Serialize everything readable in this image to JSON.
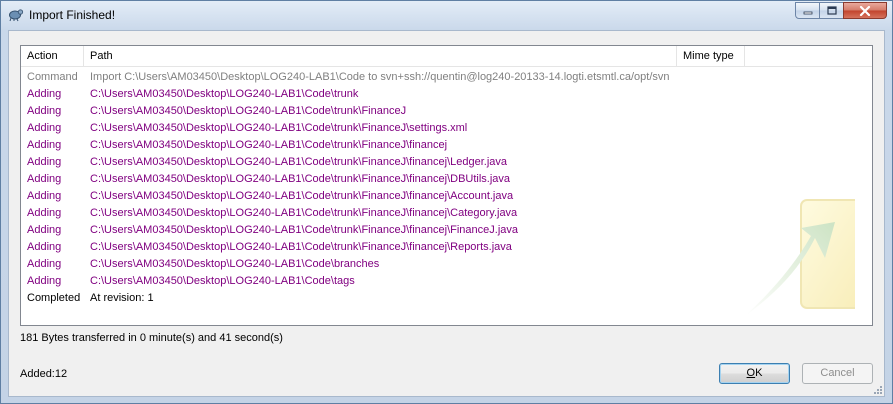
{
  "window": {
    "title": "Import Finished!"
  },
  "list": {
    "columns": [
      "Action",
      "Path",
      "Mime type"
    ],
    "rows": [
      {
        "action": "Command",
        "path": "Import C:\\Users\\AM03450\\Desktop\\LOG240-LAB1\\Code to svn+ssh://quentin@log240-20133-14.logti.etsmtl.ca/opt/svn",
        "kind": "command"
      },
      {
        "action": "Adding",
        "path": "C:\\Users\\AM03450\\Desktop\\LOG240-LAB1\\Code\\trunk",
        "kind": "adding"
      },
      {
        "action": "Adding",
        "path": "C:\\Users\\AM03450\\Desktop\\LOG240-LAB1\\Code\\trunk\\FinanceJ",
        "kind": "adding"
      },
      {
        "action": "Adding",
        "path": "C:\\Users\\AM03450\\Desktop\\LOG240-LAB1\\Code\\trunk\\FinanceJ\\settings.xml",
        "kind": "adding"
      },
      {
        "action": "Adding",
        "path": "C:\\Users\\AM03450\\Desktop\\LOG240-LAB1\\Code\\trunk\\FinanceJ\\financej",
        "kind": "adding"
      },
      {
        "action": "Adding",
        "path": "C:\\Users\\AM03450\\Desktop\\LOG240-LAB1\\Code\\trunk\\FinanceJ\\financej\\Ledger.java",
        "kind": "adding"
      },
      {
        "action": "Adding",
        "path": "C:\\Users\\AM03450\\Desktop\\LOG240-LAB1\\Code\\trunk\\FinanceJ\\financej\\DBUtils.java",
        "kind": "adding"
      },
      {
        "action": "Adding",
        "path": "C:\\Users\\AM03450\\Desktop\\LOG240-LAB1\\Code\\trunk\\FinanceJ\\financej\\Account.java",
        "kind": "adding"
      },
      {
        "action": "Adding",
        "path": "C:\\Users\\AM03450\\Desktop\\LOG240-LAB1\\Code\\trunk\\FinanceJ\\financej\\Category.java",
        "kind": "adding"
      },
      {
        "action": "Adding",
        "path": "C:\\Users\\AM03450\\Desktop\\LOG240-LAB1\\Code\\trunk\\FinanceJ\\financej\\FinanceJ.java",
        "kind": "adding"
      },
      {
        "action": "Adding",
        "path": "C:\\Users\\AM03450\\Desktop\\LOG240-LAB1\\Code\\trunk\\FinanceJ\\financej\\Reports.java",
        "kind": "adding"
      },
      {
        "action": "Adding",
        "path": "C:\\Users\\AM03450\\Desktop\\LOG240-LAB1\\Code\\branches",
        "kind": "adding"
      },
      {
        "action": "Adding",
        "path": "C:\\Users\\AM03450\\Desktop\\LOG240-LAB1\\Code\\tags",
        "kind": "adding"
      },
      {
        "action": "Completed",
        "path": "At revision: 1",
        "kind": "completed"
      }
    ]
  },
  "status": {
    "transfer": "181 Bytes transferred in 0 minute(s) and 41 second(s)",
    "added": "Added:12"
  },
  "buttons": {
    "ok_rest": "K",
    "ok_accel": "O",
    "cancel": "Cancel"
  },
  "icons": {
    "app": "tortoisesvn-icon",
    "minimize": "minimize-icon",
    "maximize": "maximize-icon",
    "close": "close-icon",
    "watermark": "svn-logo-watermark",
    "grip": "resize-grip-icon"
  },
  "colors": {
    "command": "#808080",
    "adding": "#800080",
    "completed": "#000000"
  }
}
